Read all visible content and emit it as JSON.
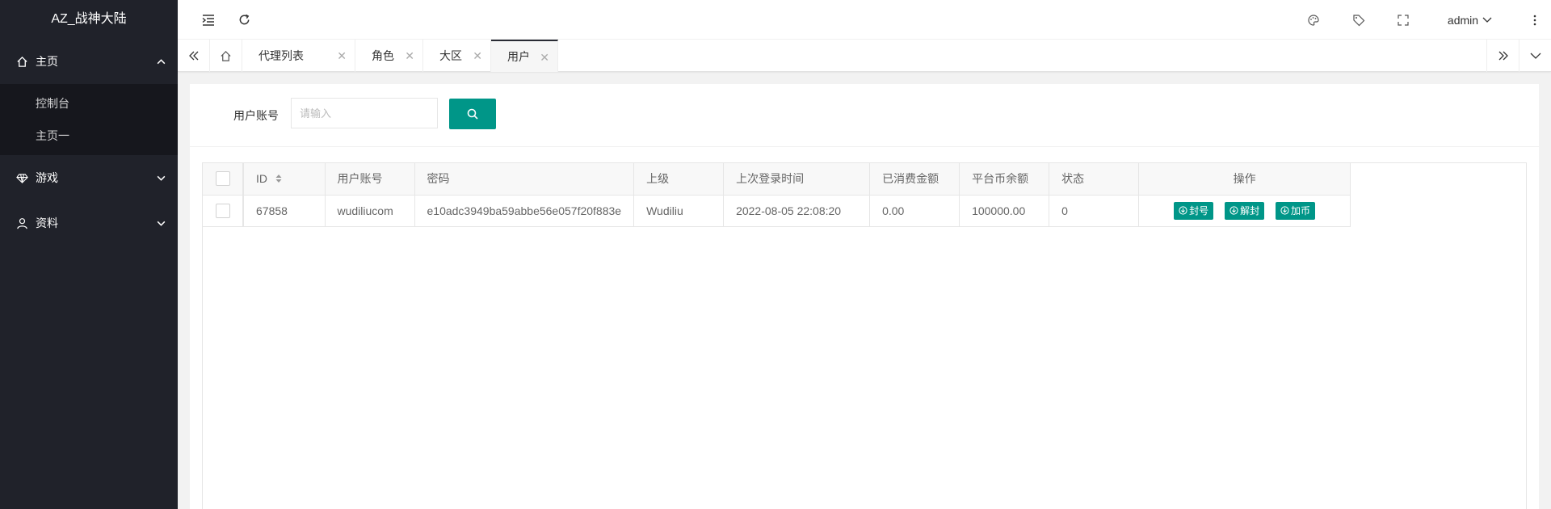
{
  "app": {
    "title": "AZ_战神大陆"
  },
  "sidebar": {
    "home": {
      "label": "主页",
      "children": [
        "控制台",
        "主页一"
      ]
    },
    "game": {
      "label": "游戏"
    },
    "data": {
      "label": "资料"
    }
  },
  "header": {
    "user": "admin"
  },
  "tabs": [
    {
      "label": "代理列表"
    },
    {
      "label": "角色"
    },
    {
      "label": "大区"
    },
    {
      "label": "用户"
    }
  ],
  "search": {
    "label": "用户账号",
    "placeholder": "请输入",
    "value": ""
  },
  "table": {
    "columns": [
      "ID",
      "用户账号",
      "密码",
      "上级",
      "上次登录时间",
      "已消费金额",
      "平台币余额",
      "状态",
      "操作"
    ],
    "rows": [
      [
        "67858",
        "wudiliucom",
        "e10adc3949ba59abbe56e057f20f883e",
        "Wudiliu",
        "2022-08-05 22:08:20",
        "0.00",
        "100000.00",
        "0"
      ]
    ],
    "actions": [
      "封号",
      "解封",
      "加币"
    ]
  },
  "colors": {
    "sidebar": "#20222a",
    "accent": "#009688",
    "subnav": "#16171d"
  }
}
